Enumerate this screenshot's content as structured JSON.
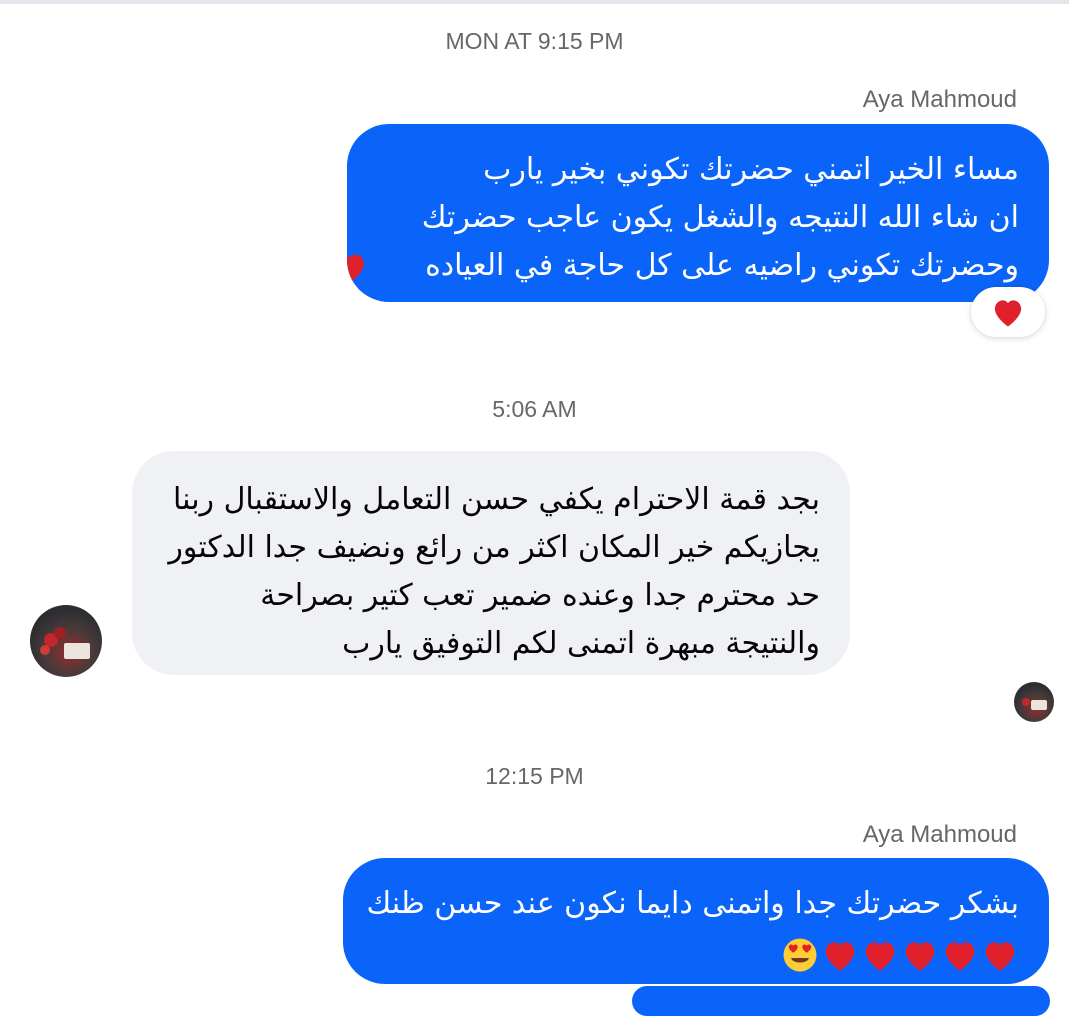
{
  "conversation": {
    "messages": [
      {
        "timestamp": "MON AT 9:15 PM",
        "sender": "Aya Mahmoud",
        "direction": "outgoing",
        "lines": [
          "مساء الخير اتمني حضرتك تكوني بخير يارب",
          "ان شاء الله النتيجه والشغل يكون عاجب حضرتك",
          "وحضرتك تكوني راضيه على كل حاجة في العياده"
        ],
        "reaction": "heart"
      },
      {
        "timestamp": "5:06 AM",
        "direction": "incoming",
        "lines": [
          "بجد قمة الاحترام يكفي حسن التعامل والاستقبال ربنا",
          "يجازيكم خير المكان اكثر من رائع ونضيف جدا الدكتور",
          "حد محترم جدا وعنده ضمير تعب كتير بصراحة",
          "والنتيجة مبهرة اتمنى لكم التوفيق يارب"
        ]
      },
      {
        "timestamp": "12:15 PM",
        "sender": "Aya Mahmoud",
        "direction": "outgoing",
        "lines": [
          "بشكر حضرتك جدا واتمنى دايما نكون عند حسن ظنك"
        ],
        "emoji_line": "heart x5, heart-eyes"
      }
    ]
  },
  "colors": {
    "outgoing_bubble": "#0a64f9",
    "incoming_bubble": "#eff1f4",
    "timestamp_text": "#65676b",
    "heart": "#e0202a"
  },
  "icons": {
    "reaction": "heart-icon",
    "avatar": "contact-avatar",
    "read_receipt": "seen-avatar"
  }
}
